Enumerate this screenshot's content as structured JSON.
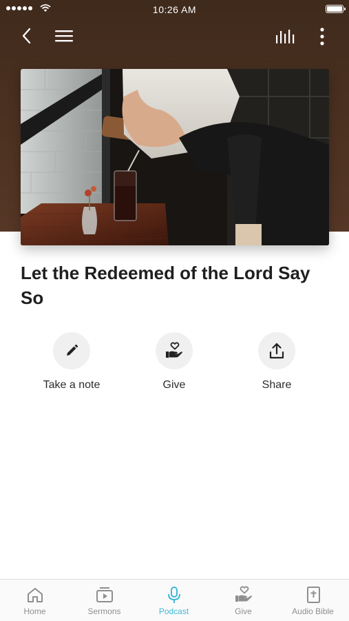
{
  "status": {
    "time": "10:26 AM"
  },
  "episode": {
    "title": "Let the Redeemed of the Lord Say So"
  },
  "actions": [
    {
      "label": "Take a note",
      "icon": "pencil-icon"
    },
    {
      "label": "Give",
      "icon": "heart-hand-icon"
    },
    {
      "label": "Share",
      "icon": "share-upload-icon"
    }
  ],
  "tabs": [
    {
      "label": "Home",
      "icon": "home-icon",
      "active": false
    },
    {
      "label": "Sermons",
      "icon": "video-icon",
      "active": false
    },
    {
      "label": "Podcast",
      "icon": "microphone-icon",
      "active": true
    },
    {
      "label": "Give",
      "icon": "heart-hand-icon",
      "active": false
    },
    {
      "label": "Audio Bible",
      "icon": "bible-icon",
      "active": false
    }
  ],
  "colors": {
    "header_brown": "#4a3020",
    "accent": "#3fb8d6",
    "tab_inactive": "#8e8e8e"
  }
}
